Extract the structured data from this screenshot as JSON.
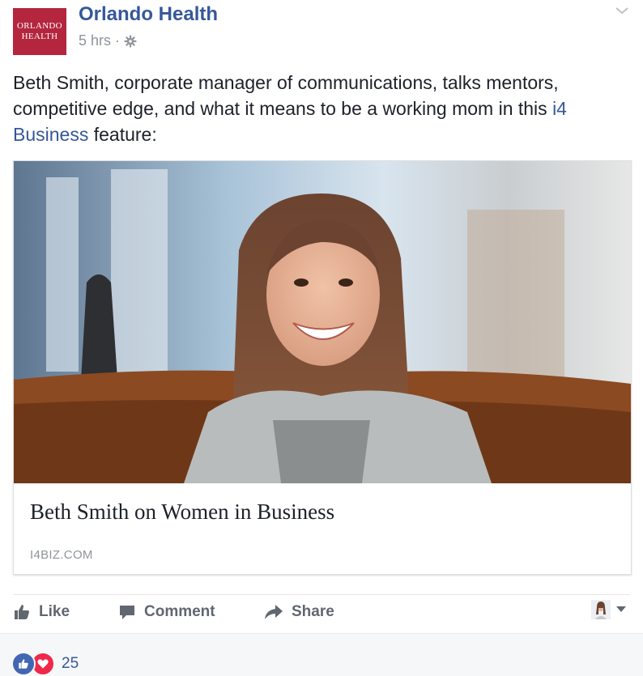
{
  "post": {
    "page_name": "Orlando Health",
    "logo_line1": "ORLANDO",
    "logo_line2": "HEALTH",
    "timestamp": "5 hrs",
    "separator": "·",
    "privacy_icon": "gear-icon",
    "text_before_link": "Beth Smith, corporate manager of communications, talks mentors, competitive edge, and what it means to be a working mom in this ",
    "link_text": "i4 Business",
    "text_after_link": " feature:"
  },
  "link_card": {
    "image_icon": "portrait-photo",
    "title": "Beth Smith on Women in Business",
    "domain": "I4BIZ.COM"
  },
  "actions": {
    "like_label": "Like",
    "comment_label": "Comment",
    "share_label": "Share"
  },
  "reactions": {
    "icons": [
      "like-reaction-icon",
      "love-reaction-icon"
    ],
    "count": "25"
  },
  "colors": {
    "brand_link": "#365899",
    "logo_bg": "#b3263e",
    "like_blue": "#4267b2",
    "love_red": "#f0284a"
  }
}
